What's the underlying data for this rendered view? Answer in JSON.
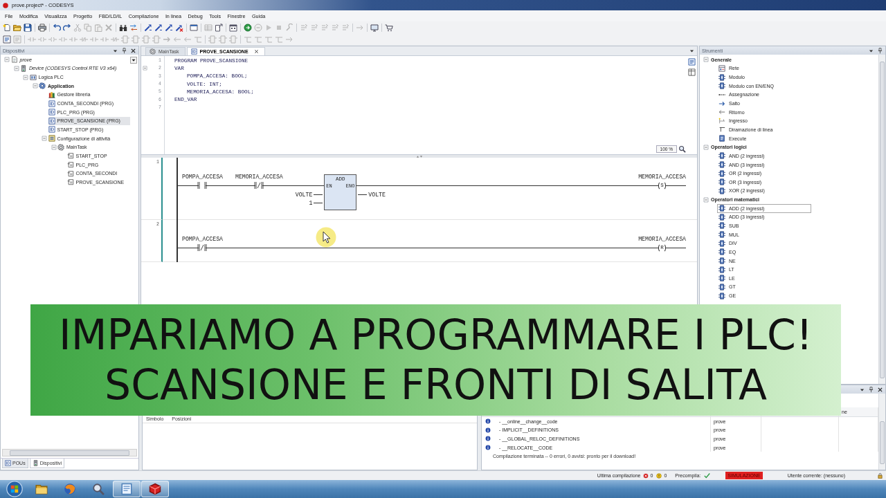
{
  "window": {
    "title": "prove.project* - CODESYS"
  },
  "menu": [
    "File",
    "Modifica",
    "Visualizza",
    "Progetto",
    "FBD/LD/IL",
    "Compilazione",
    "In linea",
    "Debug",
    "Tools",
    "Finestre",
    "Guida"
  ],
  "toolbar_main": [
    {
      "kind": "new",
      "disabled": false
    },
    {
      "kind": "open",
      "disabled": false
    },
    {
      "kind": "save",
      "disabled": false
    },
    {
      "kind": "separator"
    },
    {
      "kind": "print",
      "disabled": false
    },
    {
      "kind": "separator"
    },
    {
      "kind": "undo",
      "disabled": false
    },
    {
      "kind": "redo",
      "disabled": false
    },
    {
      "kind": "cut",
      "disabled": true
    },
    {
      "kind": "copy",
      "disabled": true
    },
    {
      "kind": "paste",
      "disabled": true
    },
    {
      "kind": "delete",
      "disabled": true
    },
    {
      "kind": "separator"
    },
    {
      "kind": "find",
      "disabled": false
    },
    {
      "kind": "replace",
      "disabled": false
    },
    {
      "kind": "separator"
    },
    {
      "kind": "build",
      "disabled": false
    },
    {
      "kind": "build",
      "disabled": false
    },
    {
      "kind": "build",
      "disabled": false
    },
    {
      "kind": "clean",
      "disabled": false
    },
    {
      "kind": "separator"
    },
    {
      "kind": "window",
      "disabled": false
    },
    {
      "kind": "separator"
    },
    {
      "kind": "grid",
      "disabled": true
    },
    {
      "kind": "export",
      "disabled": false
    },
    {
      "kind": "separator"
    },
    {
      "kind": "calendar",
      "disabled": false
    },
    {
      "kind": "separator"
    },
    {
      "kind": "login",
      "disabled": false
    },
    {
      "kind": "logout",
      "disabled": true
    },
    {
      "kind": "play",
      "disabled": true
    },
    {
      "kind": "stop",
      "disabled": true
    },
    {
      "kind": "tool",
      "disabled": true
    },
    {
      "kind": "separator"
    },
    {
      "kind": "step",
      "disabled": true
    },
    {
      "kind": "step",
      "disabled": true
    },
    {
      "kind": "step",
      "disabled": true
    },
    {
      "kind": "step",
      "disabled": true
    },
    {
      "kind": "step",
      "disabled": true
    },
    {
      "kind": "separator"
    },
    {
      "kind": "arrow",
      "disabled": true
    },
    {
      "kind": "separator"
    },
    {
      "kind": "screen",
      "disabled": false
    },
    {
      "kind": "separator"
    },
    {
      "kind": "cart",
      "disabled": false
    }
  ],
  "toolbar_ladder": [
    {
      "kind": "network",
      "disabled": false
    },
    {
      "kind": "network",
      "disabled": true
    },
    {
      "kind": "separator"
    },
    {
      "kind": "contact",
      "disabled": true
    },
    {
      "kind": "coil",
      "disabled": true
    },
    {
      "kind": "coil",
      "disabled": true
    },
    {
      "kind": "coil",
      "disabled": true
    },
    {
      "kind": "contact",
      "disabled": true
    },
    {
      "kind": "ncontact",
      "disabled": true
    },
    {
      "kind": "contact",
      "disabled": true
    },
    {
      "kind": "contact",
      "disabled": true
    },
    {
      "kind": "ncontact",
      "disabled": true
    },
    {
      "kind": "box",
      "disabled": true
    },
    {
      "kind": "box",
      "disabled": true
    },
    {
      "kind": "box",
      "disabled": true
    },
    {
      "kind": "box",
      "disabled": true
    },
    {
      "kind": "jump",
      "disabled": true
    },
    {
      "kind": "ret",
      "disabled": true
    },
    {
      "kind": "ret",
      "disabled": true
    },
    {
      "kind": "branch",
      "disabled": true
    },
    {
      "kind": "separator"
    },
    {
      "kind": "box",
      "disabled": true
    },
    {
      "kind": "box",
      "disabled": true
    },
    {
      "kind": "box",
      "disabled": true
    },
    {
      "kind": "separator"
    },
    {
      "kind": "branch",
      "disabled": true
    },
    {
      "kind": "branch",
      "disabled": true
    },
    {
      "kind": "branch",
      "disabled": true
    },
    {
      "kind": "branch",
      "disabled": true
    },
    {
      "kind": "arrow",
      "disabled": true
    }
  ],
  "devices_panel": {
    "title": "Dispositivi",
    "tree": [
      {
        "label": "prove",
        "kind": "project",
        "selected": false,
        "expanded": true,
        "children": [
          {
            "label": "Device (CODESYS Control RTE V3 x64)",
            "kind": "device",
            "selected": false,
            "expanded": true,
            "children": [
              {
                "label": "Logica PLC",
                "kind": "plc",
                "selected": false,
                "expanded": true,
                "children": [
                  {
                    "label": "Application",
                    "kind": "application",
                    "selected": false,
                    "expanded": true,
                    "children": [
                      {
                        "label": "Gestore libreria",
                        "kind": "library",
                        "selected": false
                      },
                      {
                        "label": "CONTA_SECONDI (PRG)",
                        "kind": "pou",
                        "selected": false
                      },
                      {
                        "label": "PLC_PRG (PRG)",
                        "kind": "pou",
                        "selected": false
                      },
                      {
                        "label": "PROVE_SCANSIONE (PRG)",
                        "kind": "pou",
                        "selected": true
                      },
                      {
                        "label": "START_STOP (PRG)",
                        "kind": "pou",
                        "selected": false
                      },
                      {
                        "label": "Configurazione di attività",
                        "kind": "taskconfig",
                        "selected": false,
                        "expanded": true,
                        "children": [
                          {
                            "label": "MainTask",
                            "kind": "task",
                            "selected": false,
                            "expanded": true,
                            "children": [
                              {
                                "label": "START_STOP",
                                "kind": "call",
                                "selected": false
                              },
                              {
                                "label": "PLC_PRG",
                                "kind": "call",
                                "selected": false
                              },
                              {
                                "label": "CONTA_SECONDI",
                                "kind": "call",
                                "selected": false
                              },
                              {
                                "label": "PROVE_SCANSIONE",
                                "kind": "call",
                                "selected": false
                              }
                            ]
                          }
                        ]
                      }
                    ]
                  }
                ]
              }
            ]
          }
        ]
      }
    ],
    "tabs": [
      {
        "label": "POUs",
        "kind": "pou",
        "selected": false
      },
      {
        "label": "Dispositivi",
        "kind": "devices",
        "selected": true
      }
    ]
  },
  "editor": {
    "tabs": [
      {
        "label": "MainTask",
        "kind": "task",
        "selected": false,
        "closable": false
      },
      {
        "label": "PROVE_SCANSIONE",
        "kind": "pou",
        "selected": true,
        "closable": true
      }
    ],
    "declaration": [
      {
        "number": "1",
        "code": "PROGRAM PROVE_SCANSIONE"
      },
      {
        "number": "2",
        "code": "VAR",
        "expanded": true,
        "children": [
          {
            "number": "3",
            "code": "POMPA_ACCESA: BOOL;"
          },
          {
            "number": "4",
            "code": "VOLTE: INT;"
          },
          {
            "number": "5",
            "code": "MEMORIA_ACCESA: BOOL;"
          }
        ]
      },
      {
        "number": "6",
        "code": "END_VAR"
      },
      {
        "number": "7"
      }
    ],
    "zoom": "100 %",
    "networks": [
      {
        "number": "1",
        "elements": [
          {
            "kind": "contact",
            "negated": false,
            "variable": "POMPA_ACCESA"
          },
          {
            "kind": "contact",
            "negated": true,
            "variable": "MEMORIA_ACCESA"
          },
          {
            "kind": "block",
            "name": "ADD",
            "en": "EN",
            "eno": "ENO",
            "inputs": [
              "VOLTE",
              "1"
            ],
            "outputs": [
              "VOLTE"
            ]
          },
          {
            "kind": "coil",
            "letter": "S",
            "variable": "MEMORIA_ACCESA"
          }
        ]
      },
      {
        "number": "2",
        "elements": [
          {
            "kind": "contact",
            "negated": true,
            "variable": "POMPA_ACCESA"
          },
          {
            "kind": "coil",
            "letter": "R",
            "variable": "MEMORIA_ACCESA"
          }
        ]
      }
    ]
  },
  "tools_panel": {
    "title": "Strumenti",
    "groups": [
      {
        "label": "Generale",
        "expanded": true,
        "items": [
          {
            "label": "Rete",
            "kind": "network",
            "selected": false
          },
          {
            "label": "Modulo",
            "kind": "block",
            "selected": false
          },
          {
            "label": "Modulo con EN/ENQ",
            "kind": "block",
            "selected": false
          },
          {
            "label": "Assegnazione",
            "kind": "assignment",
            "selected": false
          },
          {
            "label": "Salto",
            "kind": "jump",
            "selected": false
          },
          {
            "label": "Ritorno",
            "kind": "return",
            "selected": false
          },
          {
            "label": "Ingresso",
            "kind": "input",
            "selected": false
          },
          {
            "label": "Diramazione di linea",
            "kind": "branch",
            "selected": false
          },
          {
            "label": "Execute",
            "kind": "execute",
            "selected": false
          }
        ]
      },
      {
        "label": "Operatori logici",
        "expanded": true,
        "items": [
          {
            "label": "AND (2 ingressi)",
            "kind": "block",
            "selected": false
          },
          {
            "label": "AND (3 ingressi)",
            "kind": "block",
            "selected": false
          },
          {
            "label": "OR (2 ingressi)",
            "kind": "block",
            "selected": false
          },
          {
            "label": "OR (3 ingressi)",
            "kind": "block",
            "selected": false
          },
          {
            "label": "XOR (2 ingressi)",
            "kind": "block",
            "selected": false
          }
        ]
      },
      {
        "label": "Operatori matematici",
        "expanded": true,
        "items": [
          {
            "label": "ADD (2 ingressi)",
            "kind": "block",
            "selected": true
          },
          {
            "label": "ADD (3 ingressi)",
            "kind": "block",
            "selected": false
          },
          {
            "label": "SUB",
            "kind": "block",
            "selected": false
          },
          {
            "label": "MUL",
            "kind": "block",
            "selected": false
          },
          {
            "label": "DIV",
            "kind": "block",
            "selected": false
          },
          {
            "label": "EQ",
            "kind": "block",
            "selected": false
          },
          {
            "label": "NE",
            "kind": "block",
            "selected": false
          },
          {
            "label": "LT",
            "kind": "block",
            "selected": false
          },
          {
            "label": "LE",
            "kind": "block",
            "selected": false
          },
          {
            "label": "GT",
            "kind": "block",
            "selected": false
          },
          {
            "label": "GE",
            "kind": "block",
            "selected": false
          }
        ]
      }
    ]
  },
  "xref_panel": {
    "columns": [
      "Simbolo",
      "Posizioni"
    ]
  },
  "messages_panel": {
    "column_header": "ne",
    "rows": [
      {
        "kind": "info",
        "text": "- __online__change__code",
        "project": "prove"
      },
      {
        "kind": "info",
        "text": "- IMPLICIT__DEFINITIONS",
        "project": "prove"
      },
      {
        "kind": "info",
        "text": "- __GLOBAL_RELOC_DEFINITIONS",
        "project": "prove"
      },
      {
        "kind": "info",
        "text": "- __RELOCATE__CODE",
        "project": "prove"
      }
    ],
    "summary": "Compilazione terminata -- 0 errori, 0 avvisi: pronto per il download!"
  },
  "status_bar": {
    "last_build": "Ultima compilazione",
    "errors": "0",
    "warnings": "0",
    "precompile": "Precompila:",
    "precompile_ok": true,
    "mode": "SIMULAZIONE",
    "user": "Utente corrente: (nessuno)"
  },
  "taskbar": [
    {
      "kind": "start",
      "active": false
    },
    {
      "kind": "folder",
      "active": false
    },
    {
      "kind": "globe",
      "active": false
    },
    {
      "kind": "magnifier",
      "active": false
    },
    {
      "kind": "window",
      "active": true
    },
    {
      "kind": "cube",
      "active": true
    }
  ],
  "banner": {
    "lines": [
      "IMPARIAMO A PROGRAMMARE I PLC!",
      "SCANSIONE E FRONTI DI SALITA"
    ]
  }
}
